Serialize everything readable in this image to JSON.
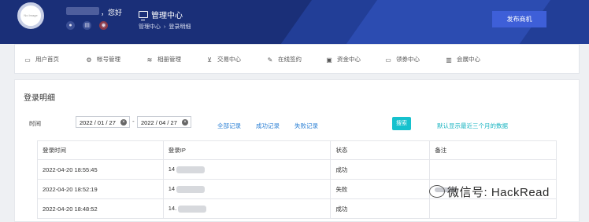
{
  "header": {
    "avatar_text": "No Image",
    "greeting": "，您好",
    "title": "管理中心",
    "breadcrumb": [
      "管理中心",
      "登录明细"
    ],
    "publish_button": "发布商机"
  },
  "nav": {
    "items": [
      {
        "label": "用户首页",
        "icon": "monitor-icon"
      },
      {
        "label": "帐号管理",
        "icon": "gear-icon"
      },
      {
        "label": "相册管理",
        "icon": "layers-icon"
      },
      {
        "label": "交易中心",
        "icon": "cart-icon"
      },
      {
        "label": "在线签约",
        "icon": "pen-icon"
      },
      {
        "label": "资金中心",
        "icon": "wallet-icon"
      },
      {
        "label": "领券中心",
        "icon": "monitor-icon"
      },
      {
        "label": "会展中心",
        "icon": "book-icon"
      }
    ]
  },
  "main": {
    "title": "登录明细",
    "filter": {
      "time_label": "时间",
      "start_date": "2022 / 01 / 27",
      "end_date": "2022 / 04 / 27",
      "separator": "-",
      "links": [
        "全部记录",
        "成功记录",
        "失败记录"
      ],
      "search_button": "搜索",
      "hint": "默认显示最近三个月的数据"
    },
    "table": {
      "columns": [
        "登录时间",
        "登录IP",
        "状态",
        "备注"
      ],
      "rows": [
        {
          "time": "2022-04-20 18:55:45",
          "ip": "14",
          "status": "成功",
          "note": ""
        },
        {
          "time": "2022-04-20 18:52:19",
          "ip": "14",
          "status": "失败",
          "note": ""
        },
        {
          "time": "2022-04-20 18:48:52",
          "ip": "14.",
          "status": "成功",
          "note": ""
        }
      ]
    }
  },
  "watermark": "微信号: HackRead",
  "colors": {
    "header_bg": "#1a2f78",
    "publish_button": "#3e5fd8",
    "search_button": "#16c1cd",
    "link": "#2a7fd4"
  }
}
